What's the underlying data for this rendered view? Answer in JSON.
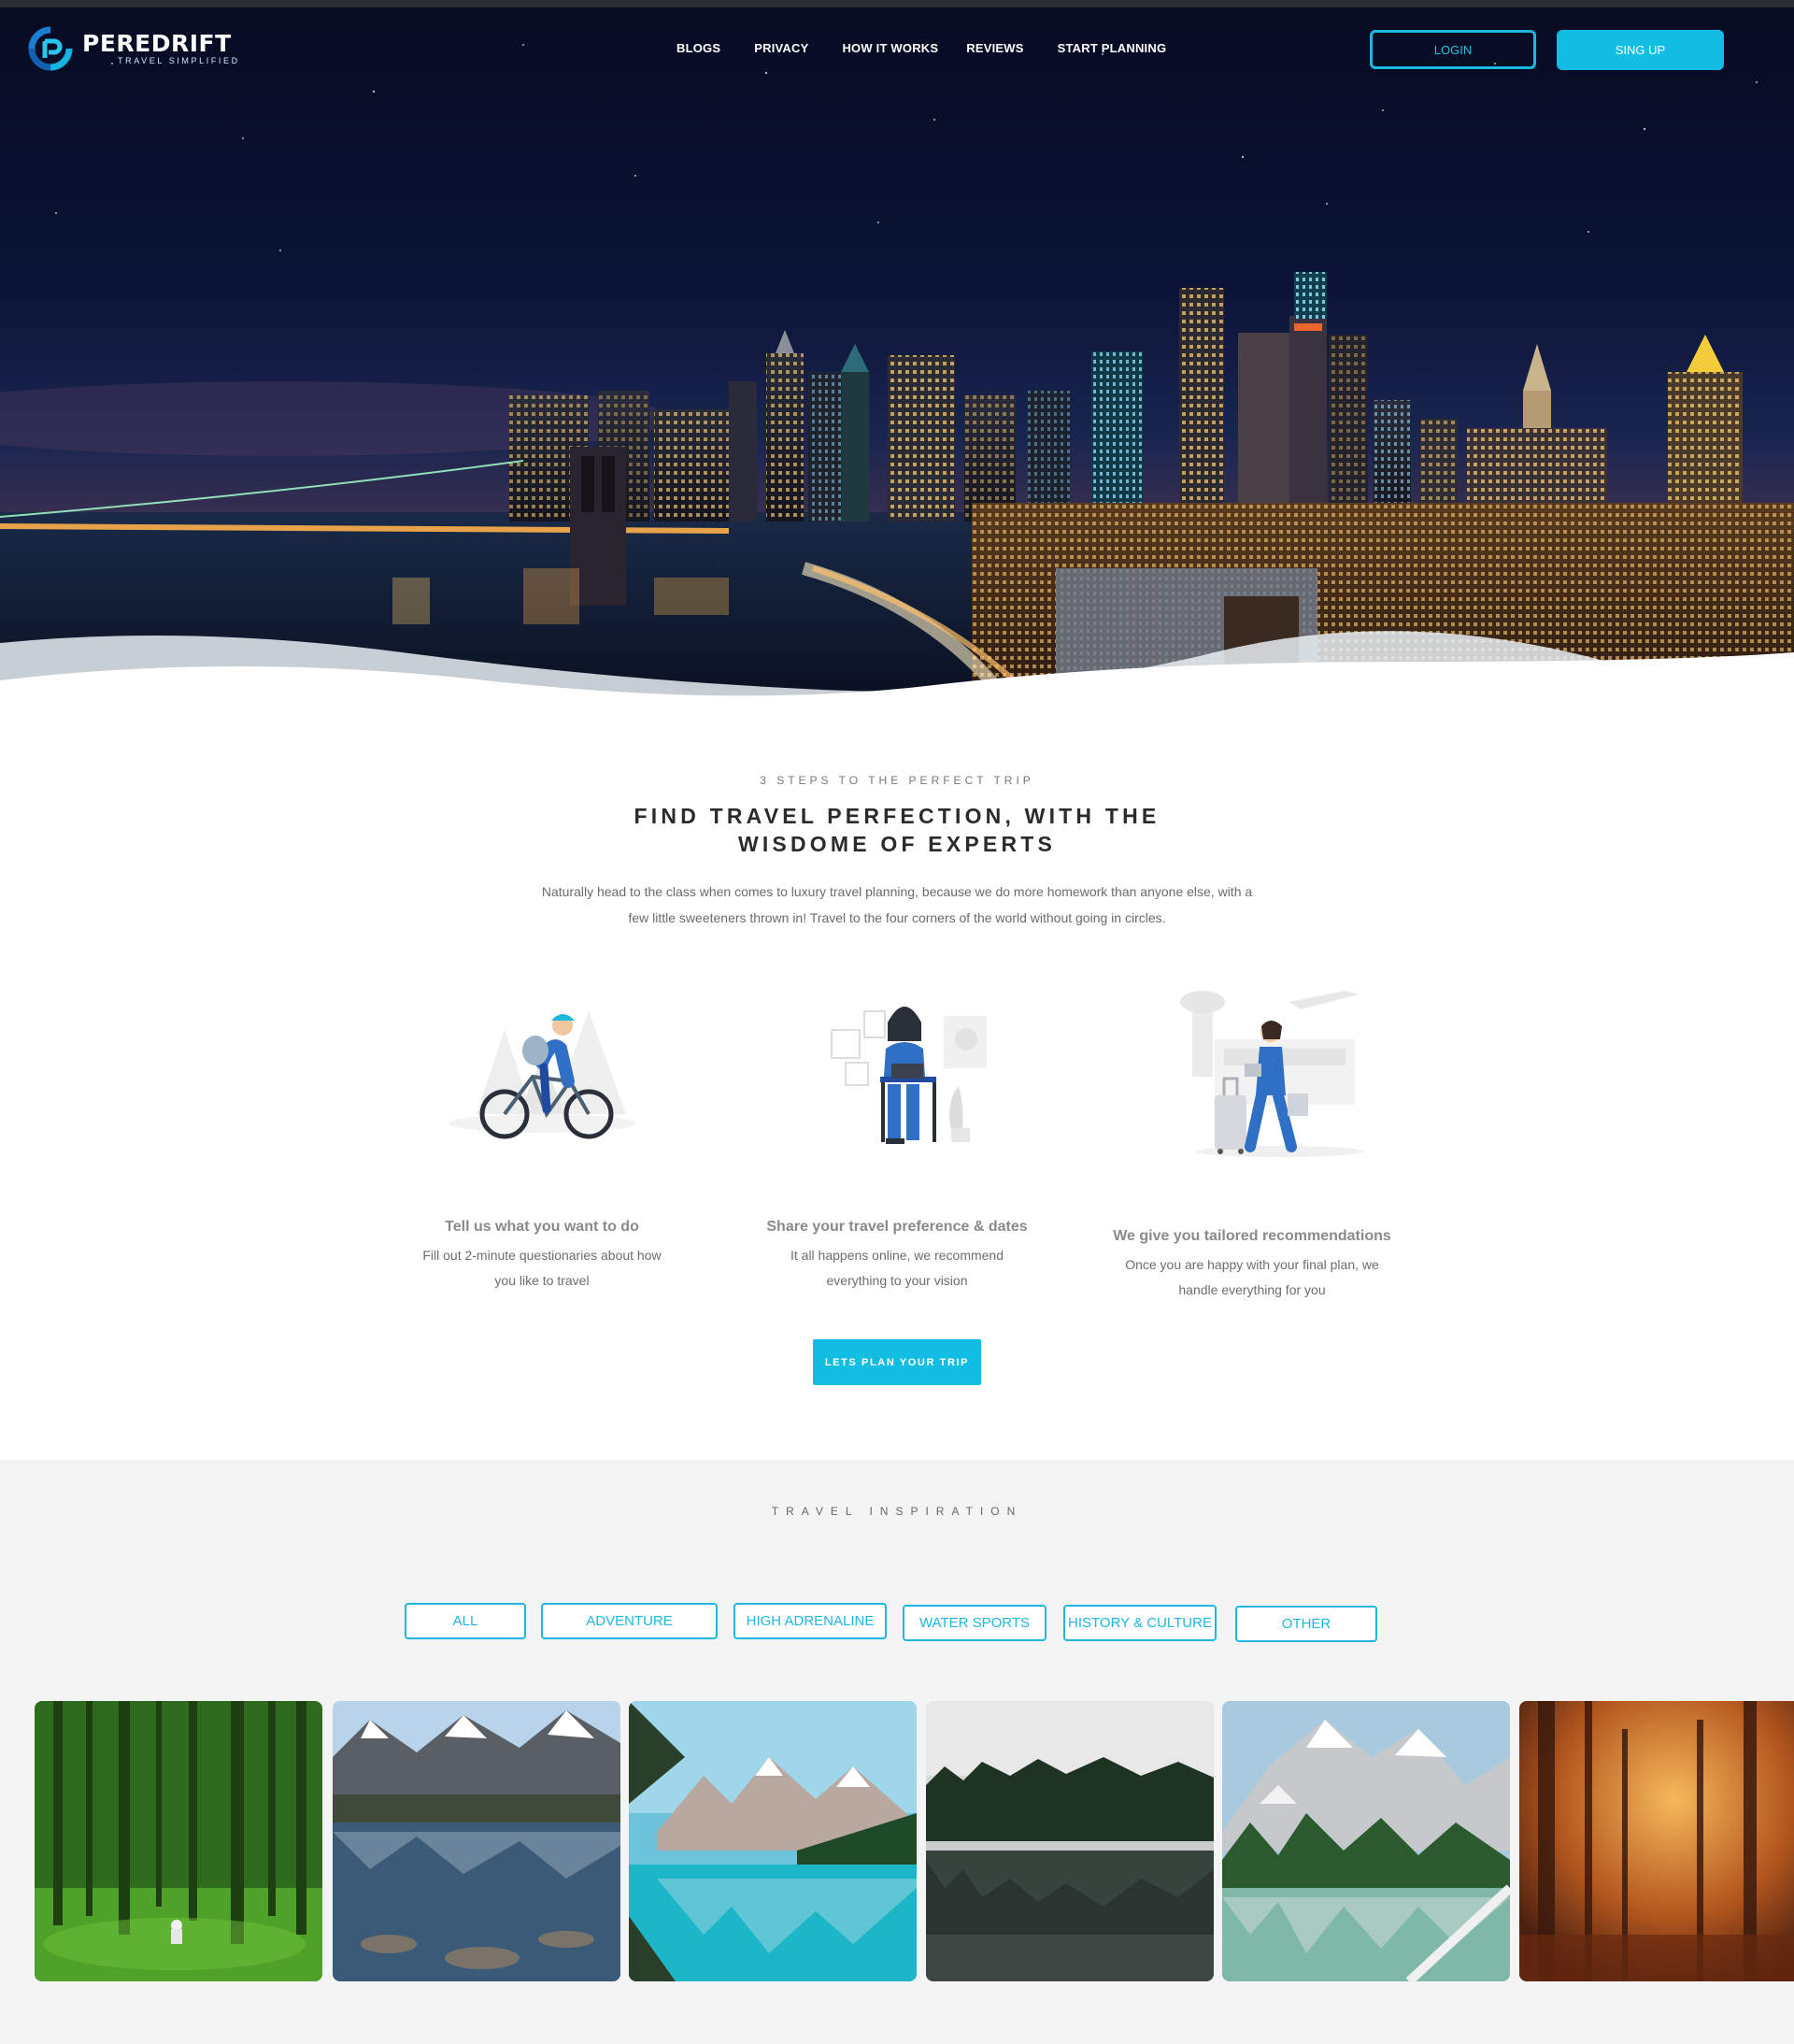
{
  "brand": {
    "name": "PEREDRIFT",
    "tagline": "TRAVEL SIMPLIFIED",
    "accent": "#12bde3"
  },
  "nav": {
    "items": [
      "BLOGS",
      "PRIVACY",
      "HOW IT WORKS",
      "REVIEWS",
      "START PLANNING"
    ]
  },
  "auth": {
    "login": "LOGIN",
    "signup": "SING UP"
  },
  "steps": {
    "eyebrow": "3 STEPS TO THE PERFECT TRIP",
    "title_line1": "FIND TRAVEL PERFECTION, WITH THE",
    "title_line2": "WISDOME OF EXPERTS",
    "desc_line1": "Naturally head to the class when comes to luxury travel planning, because we do more homework than anyone else, with a",
    "desc_line2": "few little sweeteners thrown in! Travel to the four corners of the world without going in circles.",
    "items": [
      {
        "icon": "cyclist-illustration",
        "title": "Tell us what you want to do",
        "text1": "Fill out 2-minute questionaries about how",
        "text2": "you like to travel"
      },
      {
        "icon": "laptop-woman-illustration",
        "title": "Share your travel preference & dates",
        "text1": "It all happens online, we recommend",
        "text2": "everything to your vision"
      },
      {
        "icon": "traveler-airport-illustration",
        "title": "We give you tailored recommendations",
        "text1": "Once you are happy with your final plan, we",
        "text2": "handle everything for you"
      }
    ],
    "cta": "LETS PLAN YOUR TRIP"
  },
  "inspiration": {
    "eyebrow": "TRAVEL INSPIRATION",
    "filters": [
      "ALL",
      "ADVENTURE",
      "HIGH ADRENALINE",
      "WATER SPORTS",
      "HISTORY & CULTURE",
      "OTHER"
    ],
    "photos": [
      "green-forest-photo",
      "mountain-lake-rocks-photo",
      "turquoise-mountain-lake-photo",
      "misty-forest-lake-photo",
      "alpine-lake-photo",
      "autumn-forest-photo"
    ]
  }
}
